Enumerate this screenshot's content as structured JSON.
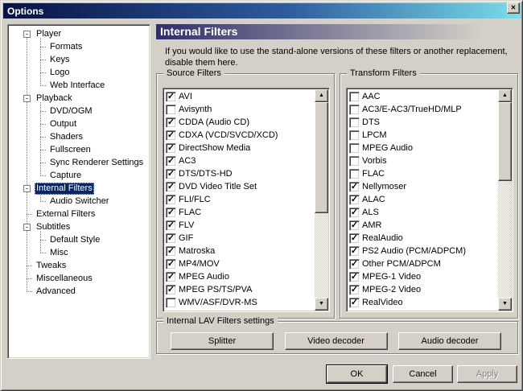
{
  "window": {
    "title": "Options",
    "close_glyph": "✕"
  },
  "icons": {
    "scroll_up": "▲",
    "scroll_down": "▼",
    "check": "✓",
    "collapse": "-"
  },
  "colors": {
    "dialog_bg": "#d4d0c8",
    "accent_navy": "#0a246a",
    "titlebar_gradient_left": "#071243",
    "titlebar_gradient_right": "#7adee9",
    "header_gradient_left": "#2e2e6a",
    "list_bg": "#ffffff"
  },
  "tree": {
    "items": [
      {
        "label": "Player",
        "level": 0,
        "box": true,
        "selected": false
      },
      {
        "label": "Formats",
        "level": 1,
        "box": false,
        "selected": false
      },
      {
        "label": "Keys",
        "level": 1,
        "box": false,
        "selected": false
      },
      {
        "label": "Logo",
        "level": 1,
        "box": false,
        "selected": false
      },
      {
        "label": "Web Interface",
        "level": 1,
        "box": false,
        "selected": false
      },
      {
        "label": "Playback",
        "level": 0,
        "box": true,
        "selected": false
      },
      {
        "label": "DVD/OGM",
        "level": 1,
        "box": false,
        "selected": false
      },
      {
        "label": "Output",
        "level": 1,
        "box": false,
        "selected": false
      },
      {
        "label": "Shaders",
        "level": 1,
        "box": false,
        "selected": false
      },
      {
        "label": "Fullscreen",
        "level": 1,
        "box": false,
        "selected": false
      },
      {
        "label": "Sync Renderer Settings",
        "level": 1,
        "box": false,
        "selected": false
      },
      {
        "label": "Capture",
        "level": 1,
        "box": false,
        "selected": false
      },
      {
        "label": "Internal Filters",
        "level": 0,
        "box": true,
        "selected": true
      },
      {
        "label": "Audio Switcher",
        "level": 1,
        "box": false,
        "selected": false
      },
      {
        "label": "External Filters",
        "level": 0,
        "box": false,
        "selected": false
      },
      {
        "label": "Subtitles",
        "level": 0,
        "box": true,
        "selected": false
      },
      {
        "label": "Default Style",
        "level": 1,
        "box": false,
        "selected": false
      },
      {
        "label": "Misc",
        "level": 1,
        "box": false,
        "selected": false
      },
      {
        "label": "Tweaks",
        "level": 0,
        "box": false,
        "selected": false
      },
      {
        "label": "Miscellaneous",
        "level": 0,
        "box": false,
        "selected": false
      },
      {
        "label": "Advanced",
        "level": 0,
        "box": false,
        "selected": false
      }
    ]
  },
  "main": {
    "header": "Internal Filters",
    "description_lines": [
      "If you would like to use the stand-alone versions of these filters or another replacement,",
      "disable them here."
    ],
    "source_filters": {
      "label": "Source Filters",
      "items": [
        {
          "label": "AVI",
          "checked": true
        },
        {
          "label": "Avisynth",
          "checked": false
        },
        {
          "label": "CDDA (Audio CD)",
          "checked": true
        },
        {
          "label": "CDXA (VCD/SVCD/XCD)",
          "checked": true
        },
        {
          "label": "DirectShow Media",
          "checked": true
        },
        {
          "label": "AC3",
          "checked": true
        },
        {
          "label": "DTS/DTS-HD",
          "checked": true
        },
        {
          "label": "DVD Video Title Set",
          "checked": true
        },
        {
          "label": "FLI/FLC",
          "checked": true
        },
        {
          "label": "FLAC",
          "checked": true
        },
        {
          "label": "FLV",
          "checked": true
        },
        {
          "label": "GIF",
          "checked": true
        },
        {
          "label": "Matroska",
          "checked": true
        },
        {
          "label": "MP4/MOV",
          "checked": true
        },
        {
          "label": "MPEG Audio",
          "checked": true
        },
        {
          "label": "MPEG PS/TS/PVA",
          "checked": true
        },
        {
          "label": "WMV/ASF/DVR-MS",
          "checked": false
        }
      ]
    },
    "transform_filters": {
      "label": "Transform Filters",
      "items": [
        {
          "label": "AAC",
          "checked": false
        },
        {
          "label": "AC3/E-AC3/TrueHD/MLP",
          "checked": false
        },
        {
          "label": "DTS",
          "checked": false
        },
        {
          "label": "LPCM",
          "checked": false
        },
        {
          "label": "MPEG Audio",
          "checked": false
        },
        {
          "label": "Vorbis",
          "checked": false
        },
        {
          "label": "FLAC",
          "checked": false
        },
        {
          "label": "Nellymoser",
          "checked": true
        },
        {
          "label": "ALAC",
          "checked": true
        },
        {
          "label": "ALS",
          "checked": true
        },
        {
          "label": "AMR",
          "checked": true
        },
        {
          "label": "RealAudio",
          "checked": true
        },
        {
          "label": "PS2 Audio (PCM/ADPCM)",
          "checked": true
        },
        {
          "label": "Other PCM/ADPCM",
          "checked": true
        },
        {
          "label": "MPEG-1 Video",
          "checked": true
        },
        {
          "label": "MPEG-2 Video",
          "checked": true
        },
        {
          "label": "RealVideo",
          "checked": true
        }
      ]
    },
    "lav": {
      "label": "Internal LAV Filters settings",
      "buttons": [
        "Splitter",
        "Video decoder",
        "Audio decoder"
      ]
    }
  },
  "footer": {
    "ok": "OK",
    "cancel": "Cancel",
    "apply": "Apply"
  }
}
